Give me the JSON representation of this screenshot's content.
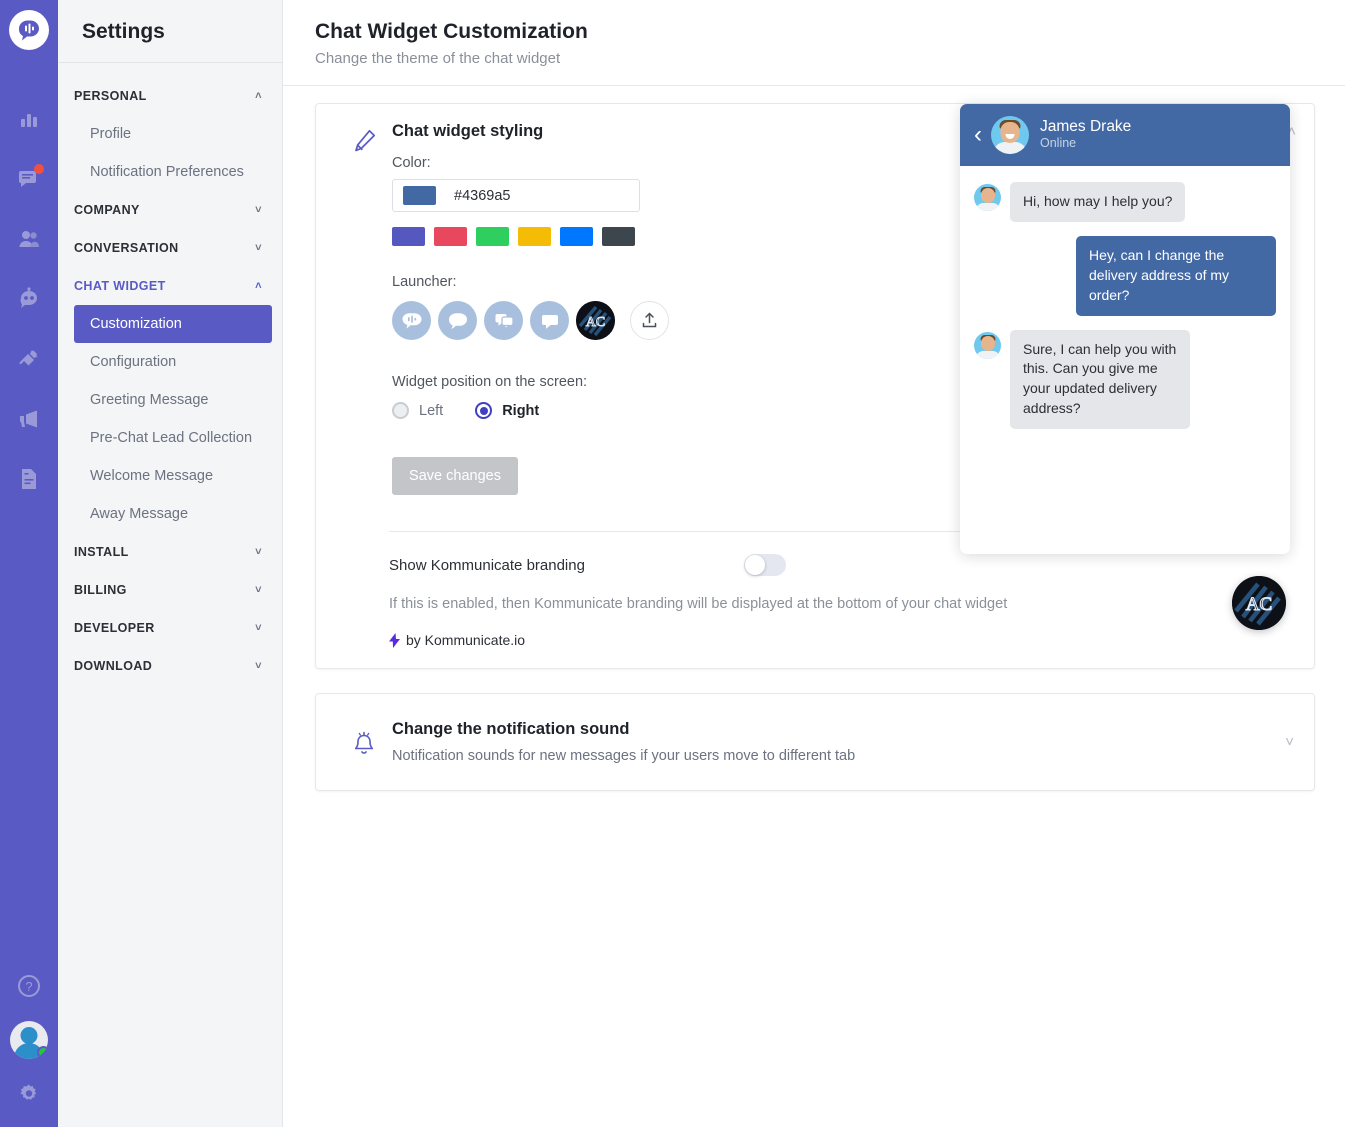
{
  "rail": {
    "logo_icon": "kommunicate-logo-icon",
    "icons": [
      {
        "name": "analytics-icon",
        "badge": false
      },
      {
        "name": "conversations-icon",
        "badge": true
      },
      {
        "name": "contacts-icon",
        "badge": false
      },
      {
        "name": "bot-icon",
        "badge": false
      },
      {
        "name": "integrations-icon",
        "badge": false
      },
      {
        "name": "campaigns-icon",
        "badge": false
      },
      {
        "name": "docs-icon",
        "badge": false
      }
    ],
    "bottom": [
      {
        "name": "help-icon"
      },
      {
        "name": "user-avatar"
      },
      {
        "name": "settings-gear-icon"
      }
    ]
  },
  "sidebar": {
    "title": "Settings",
    "groups": [
      {
        "label": "PERSONAL",
        "expanded": true,
        "chevron": "˄",
        "active": false,
        "items": [
          {
            "label": "Profile",
            "selected": false
          },
          {
            "label": "Notification Preferences",
            "selected": false
          }
        ]
      },
      {
        "label": "COMPANY",
        "expanded": false,
        "chevron": "˅",
        "active": false,
        "items": []
      },
      {
        "label": "CONVERSATION",
        "expanded": false,
        "chevron": "˅",
        "active": false,
        "items": []
      },
      {
        "label": "CHAT WIDGET",
        "expanded": true,
        "chevron": "˄",
        "active": true,
        "items": [
          {
            "label": "Customization",
            "selected": true
          },
          {
            "label": "Configuration",
            "selected": false
          },
          {
            "label": "Greeting Message",
            "selected": false
          },
          {
            "label": "Pre-Chat Lead Collection",
            "selected": false
          },
          {
            "label": "Welcome Message",
            "selected": false
          },
          {
            "label": "Away Message",
            "selected": false
          }
        ]
      },
      {
        "label": "INSTALL",
        "expanded": false,
        "chevron": "˅",
        "active": false,
        "items": []
      },
      {
        "label": "BILLING",
        "expanded": false,
        "chevron": "˅",
        "active": false,
        "items": []
      },
      {
        "label": "DEVELOPER",
        "expanded": false,
        "chevron": "˅",
        "active": false,
        "items": []
      },
      {
        "label": "DOWNLOAD",
        "expanded": false,
        "chevron": "˅",
        "active": false,
        "items": []
      }
    ]
  },
  "page": {
    "title": "Chat Widget Customization",
    "subtitle": "Change the theme of the chat widget"
  },
  "styling_card": {
    "icon": "pencil-icon",
    "title": "Chat widget styling",
    "collapse_chevron": "˄",
    "color_label": "Color:",
    "color_value": "#4369a5",
    "color_placeholder": "#4369a5",
    "swatches": [
      "#5558bf",
      "#e8485e",
      "#2ece5f",
      "#f5bc05",
      "#0077ff",
      "#3c464c"
    ],
    "launcher_label": "Launcher:",
    "launchers": [
      {
        "name": "launcher-speech-bars-icon",
        "selected": false
      },
      {
        "name": "launcher-chat-bubble-icon",
        "selected": false
      },
      {
        "name": "launcher-stacked-bubbles-icon",
        "selected": false
      },
      {
        "name": "launcher-message-square-icon",
        "selected": false
      },
      {
        "name": "launcher-custom-logo",
        "selected": true,
        "logo_text": "AC"
      },
      {
        "name": "launcher-upload-button",
        "selected": false
      }
    ],
    "position_label": "Widget position on the screen:",
    "position_options": [
      {
        "label": "Left",
        "selected": false
      },
      {
        "label": "Right",
        "selected": true
      }
    ],
    "save_label": "Save changes",
    "branding": {
      "label": "Show Kommunicate branding",
      "enabled": false,
      "description": "If this is enabled, then Kommunicate branding will be displayed at the bottom of your chat widget",
      "by_text": "by Kommunicate.io",
      "bolt_icon": "bolt-icon"
    }
  },
  "preview": {
    "header": {
      "back_icon": "back-chevron-icon",
      "name": "James Drake",
      "status": "Online"
    },
    "messages": [
      {
        "direction": "in",
        "text": "Hi, how may I help you?",
        "avatar": true
      },
      {
        "direction": "out",
        "text": "Hey, can I change the delivery address of my order?",
        "avatar": false
      },
      {
        "direction": "in",
        "text": "Sure, I can help you with this. Can you give me your updated delivery address?",
        "avatar": true
      }
    ],
    "launcher_logo_text": "AC"
  },
  "sound_card": {
    "icon": "bell-icon",
    "title": "Change the notification sound",
    "subtitle": "Notification sounds for new messages if your users move to different tab",
    "expand_chevron": "˅"
  }
}
